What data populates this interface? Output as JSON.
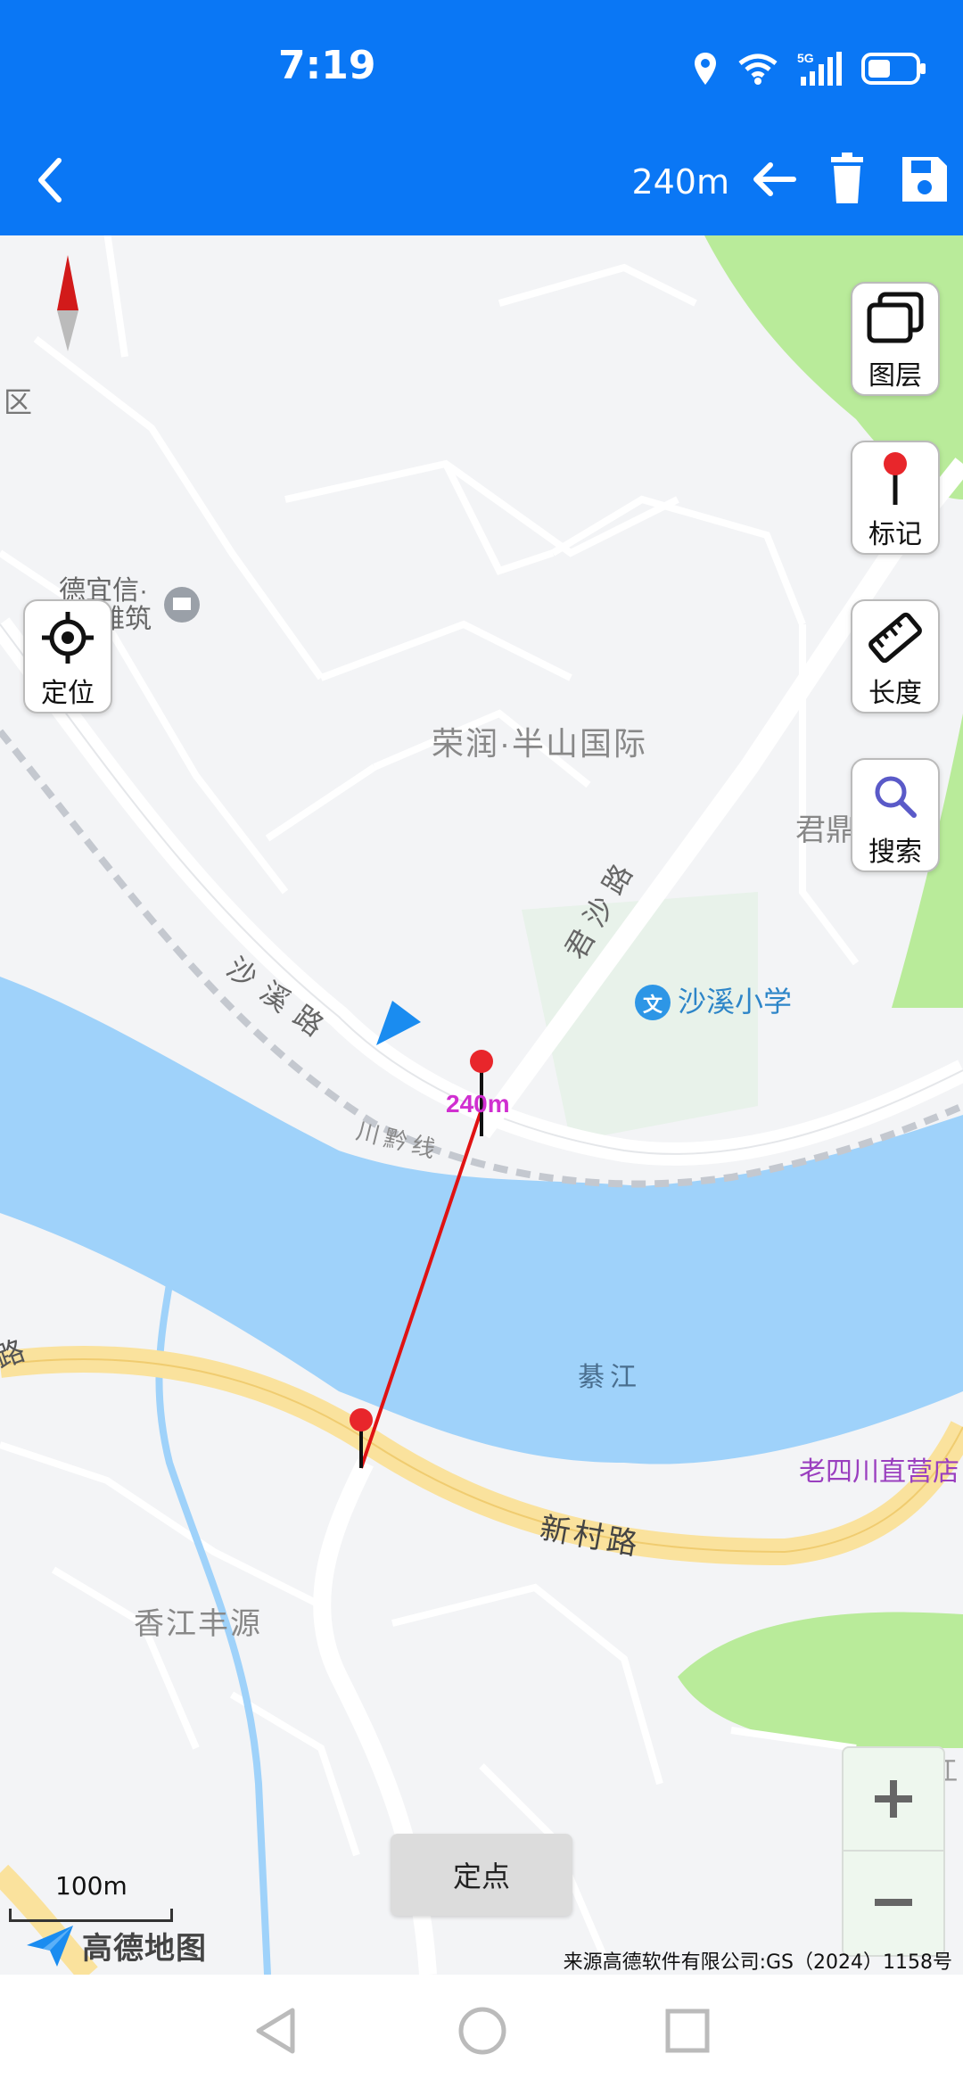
{
  "status_bar": {
    "time": "7:19",
    "icons": [
      "location-icon",
      "wifi-icon",
      "5g-signal-icon",
      "battery-icon"
    ]
  },
  "toolbar": {
    "distance": "240m",
    "icons": [
      "back-icon",
      "undo-arrow-icon",
      "trash-icon",
      "save-icon"
    ]
  },
  "side_buttons": {
    "locate": "定位",
    "layers": "图层",
    "mark": "标记",
    "length": "长度",
    "search": "搜索"
  },
  "map_labels": {
    "district": "区",
    "poi_deyixin": "德宜信·",
    "poi_yazhu": "雅筑",
    "rongrun": "荣润·半山国际",
    "junjian": "君鼎",
    "shaxi_road": "沙溪路",
    "junsha_road": "君沙路",
    "shaxi_school": "沙溪小学",
    "chuanqian_line": "川黔线",
    "qijiang": "綦江",
    "qijiang_2": "綦江",
    "lu_left": "路",
    "xincun_road": "新村路",
    "xiangjiang": "香江丰源",
    "laosichuan": "老四川直营店",
    "measurement_label": "240m"
  },
  "controls": {
    "add_point": "定点",
    "scale": "100m",
    "brand": "高德地图",
    "copyright": "来源高德软件有限公司:GS（2024）1158号"
  },
  "colors": {
    "accent": "#0a77f5",
    "river": "#9fd2fa",
    "road_major": "#fae29d",
    "green_area": "#b9eb9a",
    "measure_line": "#e01212",
    "measure_label": "#d02fd0",
    "poi_label": "#9a3fbf"
  }
}
